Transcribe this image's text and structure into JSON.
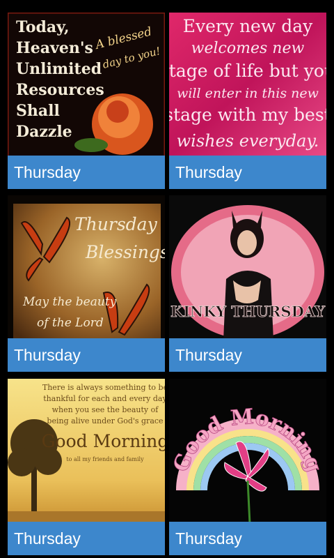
{
  "colors": {
    "caption_bg": "#3d87cc",
    "background": "#000000"
  },
  "tiles": [
    {
      "caption": "Thursday",
      "image_text": {
        "lines": [
          "Today,",
          "Heaven's",
          "Unlimited",
          "Resources",
          "Shall",
          "Dazzle"
        ],
        "script1": "A blessed",
        "script2": "day to you!"
      }
    },
    {
      "caption": "Thursday",
      "image_text": {
        "lines": [
          "Every new day",
          "welcomes new",
          "stage of life but you",
          "will enter in this new",
          "stage with my best",
          "wishes everyday."
        ]
      }
    },
    {
      "caption": "Thursday",
      "image_text": {
        "title1": "Thursday",
        "title2": "Blessings",
        "sub1": "May the beauty",
        "sub2": "of the Lord"
      }
    },
    {
      "caption": "Thursday",
      "image_text": {
        "banner": "KINKY THURSDAY"
      }
    },
    {
      "caption": "Thursday",
      "image_text": {
        "lines": [
          "There is always something to be",
          "thankful for each and every day",
          "when you see the beauty of",
          "being alive under God's grace"
        ],
        "headline": "Good Morning",
        "small": "to all my friends and family"
      }
    },
    {
      "caption": "Thursday",
      "image_text": {
        "arc": "Good Morning"
      }
    }
  ]
}
